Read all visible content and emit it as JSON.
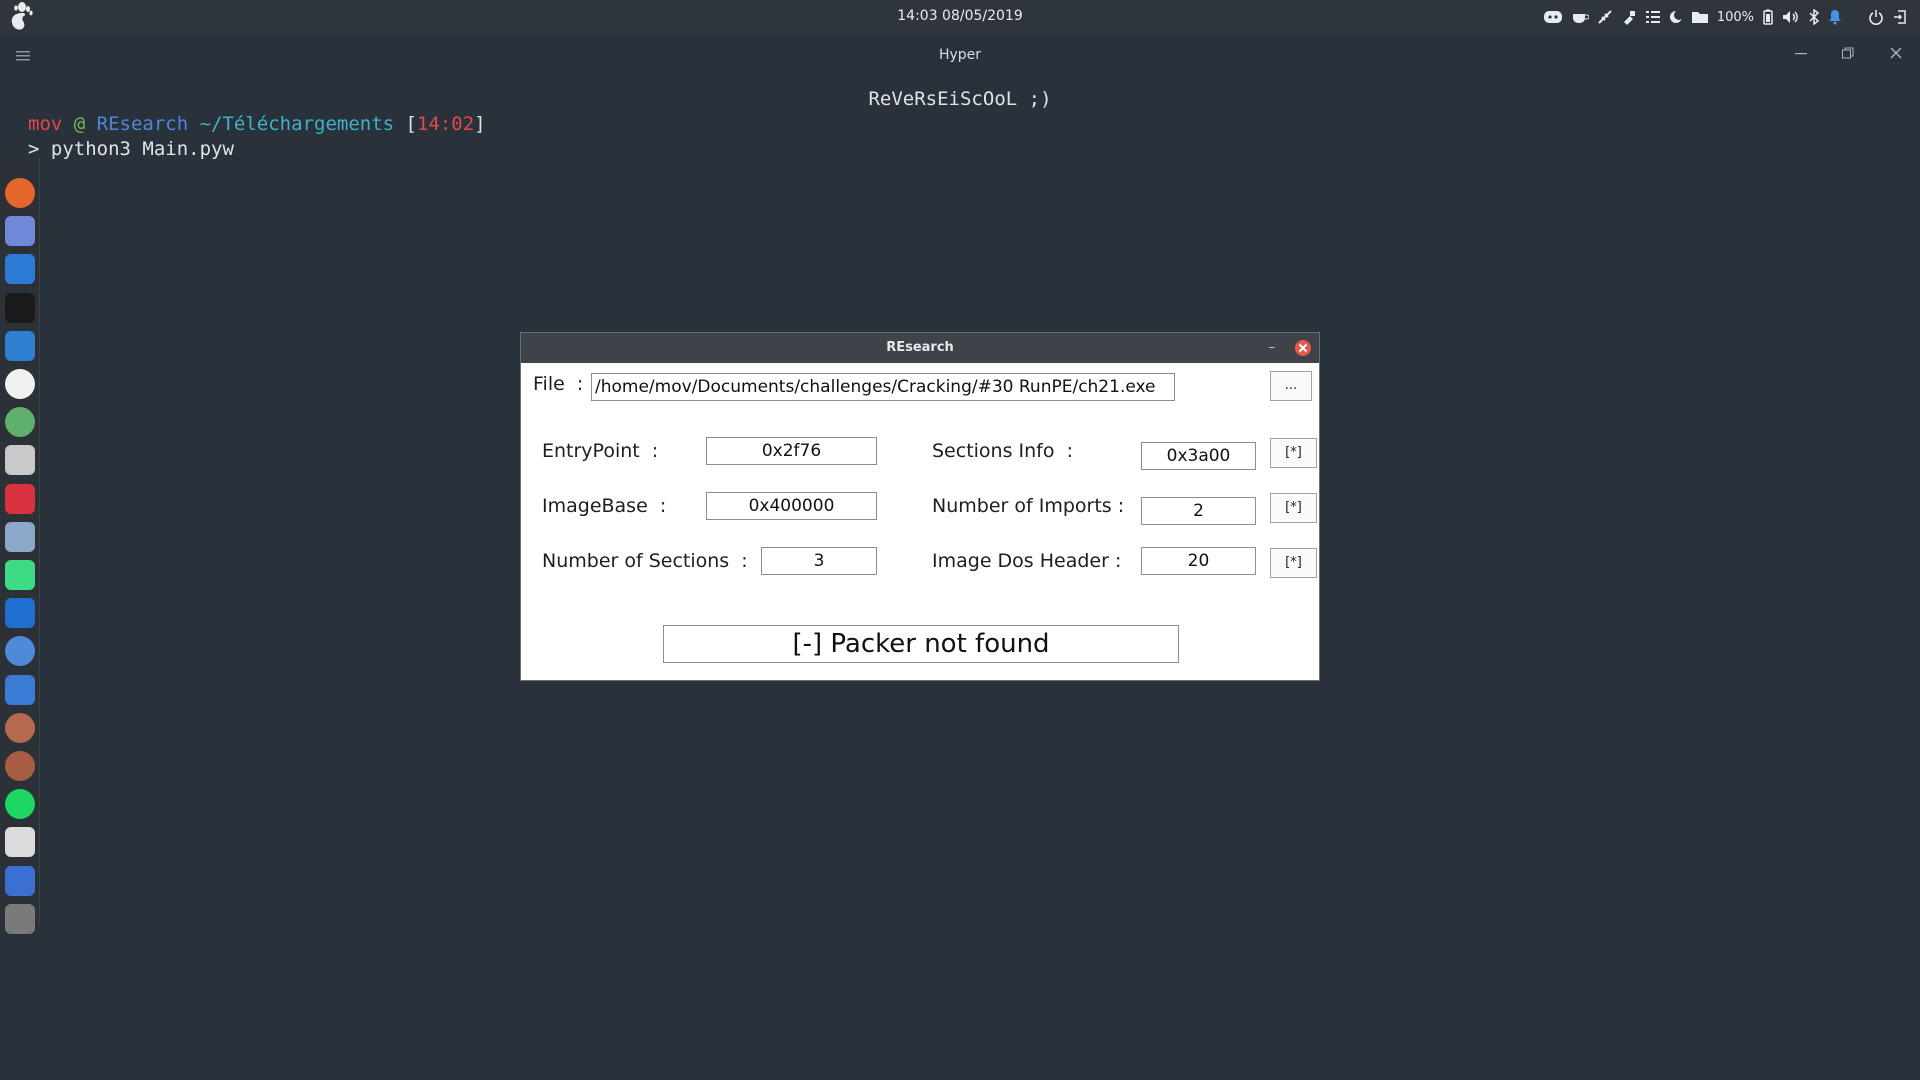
{
  "topbar": {
    "clock": "14:03 08/05/2019",
    "battery_label": "100%"
  },
  "terminal": {
    "window_title": "Hyper",
    "banner": "ReVeRsEiScOoL ;)",
    "prompt": {
      "user": "mov",
      "at": " @ ",
      "host": "REsearch",
      "path": " ~/Téléchargements",
      "open": " [",
      "time": "14:02",
      "close": "]"
    },
    "command_prompt": "> ",
    "command": "python3 Main.pyw"
  },
  "dock": {
    "items": [
      "firefox-icon",
      "discord-icon",
      "vscode-icon",
      "terminal-icon",
      "monitor-icon",
      "obs-icon",
      "atom-icon",
      "files-icon",
      "termius-icon",
      "documents-icon",
      "android-studio-icon",
      "wireshark-icon",
      "chromium-icon",
      "kdenlive-icon",
      "avatar-icon",
      "avatar-icon",
      "spotify-icon",
      "calculator-icon",
      "writer-icon",
      "help-icon"
    ],
    "colors": [
      "#e5662b",
      "#7289da",
      "#2b7bd6",
      "#1a1a1a",
      "#2f7fd1",
      "#f0f0f0",
      "#5fb06d",
      "#c9c9c9",
      "#d9333f",
      "#8ca8c9",
      "#3ddc84",
      "#1f6fd1",
      "#4f8ad9",
      "#3a7bd5",
      "#b56a50",
      "#a85c44",
      "#1ed760",
      "#dcdcdc",
      "#3b6fd1",
      "#7a7a7a"
    ]
  },
  "dialog": {
    "title": "REsearch",
    "minimize": "–",
    "file_label": "File  :",
    "file_value": "/home/mov/Documents/challenges/Cracking/#30 RunPE/ch21.exe",
    "browse_label": "...",
    "entry_label": "EntryPoint  :",
    "entry_value": "0x2f76",
    "imagebase_label": "ImageBase  :",
    "imagebase_value": "0x400000",
    "sections_label": "Number of Sections  :",
    "sections_value": "3",
    "sections_info_label": "Sections Info  :",
    "sections_info_value": "0x3a00",
    "imports_label": "Number of Imports :",
    "imports_value": "2",
    "dos_header_label": "Image Dos Header :",
    "dos_header_value": "20",
    "detail_button": "[*]",
    "packer_status": "[-] Packer not found"
  }
}
